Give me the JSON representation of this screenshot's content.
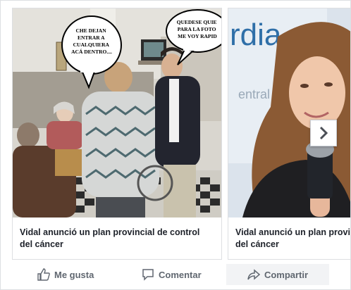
{
  "feed": {
    "cards": [
      {
        "caption": "Vidal anunció un plan provincial de control del cáncer",
        "bubble_left": [
          "CHE DEJAN",
          "ENTRAR A",
          "CUALQUIERA",
          "ACÁ DENTRO...."
        ],
        "bubble_right": [
          "QUEDESE QUIE",
          "PARA LA FOTO",
          "ME VOY RAPID"
        ]
      },
      {
        "caption": "Vidal anunció un plan provincial de control del cáncer",
        "banner_text": "rdia",
        "banner_subtext": "entral"
      }
    ],
    "next_icon": "chevron-right-icon"
  },
  "actions": {
    "like_label": "Me gusta",
    "comment_label": "Comentar",
    "share_label": "Compartir"
  }
}
